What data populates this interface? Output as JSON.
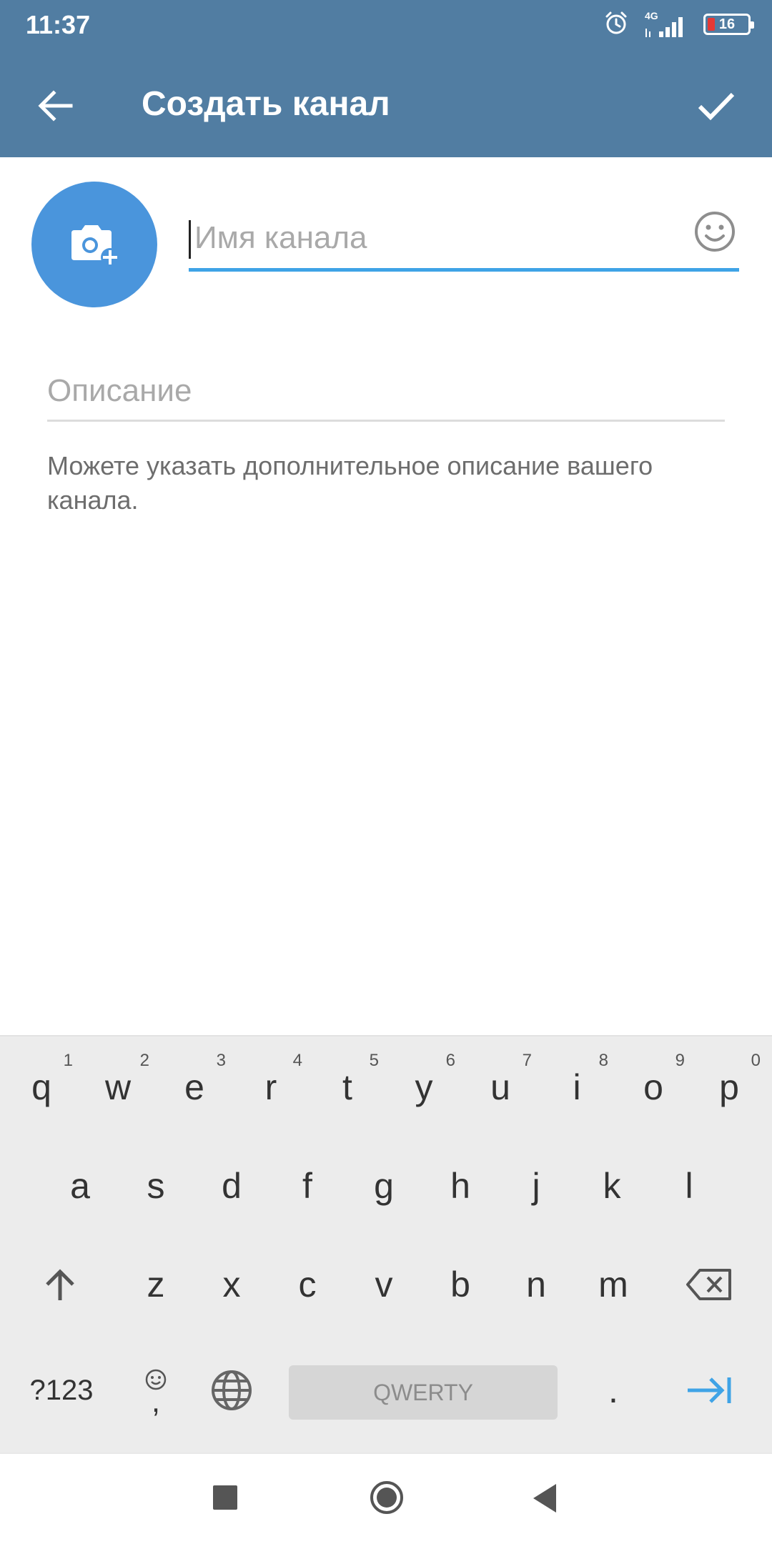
{
  "status_bar": {
    "time": "11:37",
    "network": "4G",
    "battery_level": "16",
    "icons": [
      "alarm-icon",
      "signal-icon",
      "battery-icon"
    ]
  },
  "app_bar": {
    "title": "Создать канал",
    "background": "#517da2",
    "back_icon": "arrow-left-icon",
    "done_icon": "checkmark-icon"
  },
  "form": {
    "photo_icon": "camera-add-icon",
    "name_placeholder": "Имя канала",
    "name_value": "",
    "emoji_icon": "smile-icon",
    "description_placeholder": "Описание",
    "description_value": "",
    "description_help": "Можете указать дополнительное описание вашего канала."
  },
  "keyboard": {
    "row1": [
      {
        "label": "q",
        "hint": "1"
      },
      {
        "label": "w",
        "hint": "2"
      },
      {
        "label": "e",
        "hint": "3"
      },
      {
        "label": "r",
        "hint": "4"
      },
      {
        "label": "t",
        "hint": "5"
      },
      {
        "label": "y",
        "hint": "6"
      },
      {
        "label": "u",
        "hint": "7"
      },
      {
        "label": "i",
        "hint": "8"
      },
      {
        "label": "o",
        "hint": "9"
      },
      {
        "label": "p",
        "hint": "0"
      }
    ],
    "row2": [
      "a",
      "s",
      "d",
      "f",
      "g",
      "h",
      "j",
      "k",
      "l"
    ],
    "row3": [
      "z",
      "x",
      "c",
      "v",
      "b",
      "n",
      "m"
    ],
    "symbols_label": "?123",
    "comma_label": ",",
    "space_label": "QWERTY",
    "period_label": ".",
    "accent_color": "#3fa3e6"
  },
  "nav_bar": {
    "icons": [
      "recent-apps-icon",
      "home-icon",
      "back-icon"
    ]
  }
}
